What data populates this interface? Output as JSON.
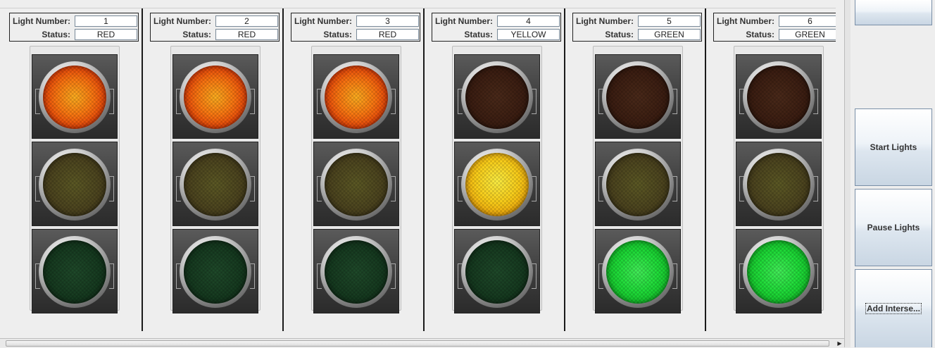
{
  "labels": {
    "light_number": "Light Number:",
    "status": "Status:"
  },
  "lights": [
    {
      "number": "1",
      "status": "RED"
    },
    {
      "number": "2",
      "status": "RED"
    },
    {
      "number": "3",
      "status": "RED"
    },
    {
      "number": "4",
      "status": "YELLOW"
    },
    {
      "number": "5",
      "status": "GREEN"
    },
    {
      "number": "6",
      "status": "GREEN"
    }
  ],
  "buttons": {
    "start": "Start Lights",
    "pause": "Pause Lights",
    "add": "Add Interse..."
  },
  "scrollbar": {
    "right_arrow": "▶"
  }
}
